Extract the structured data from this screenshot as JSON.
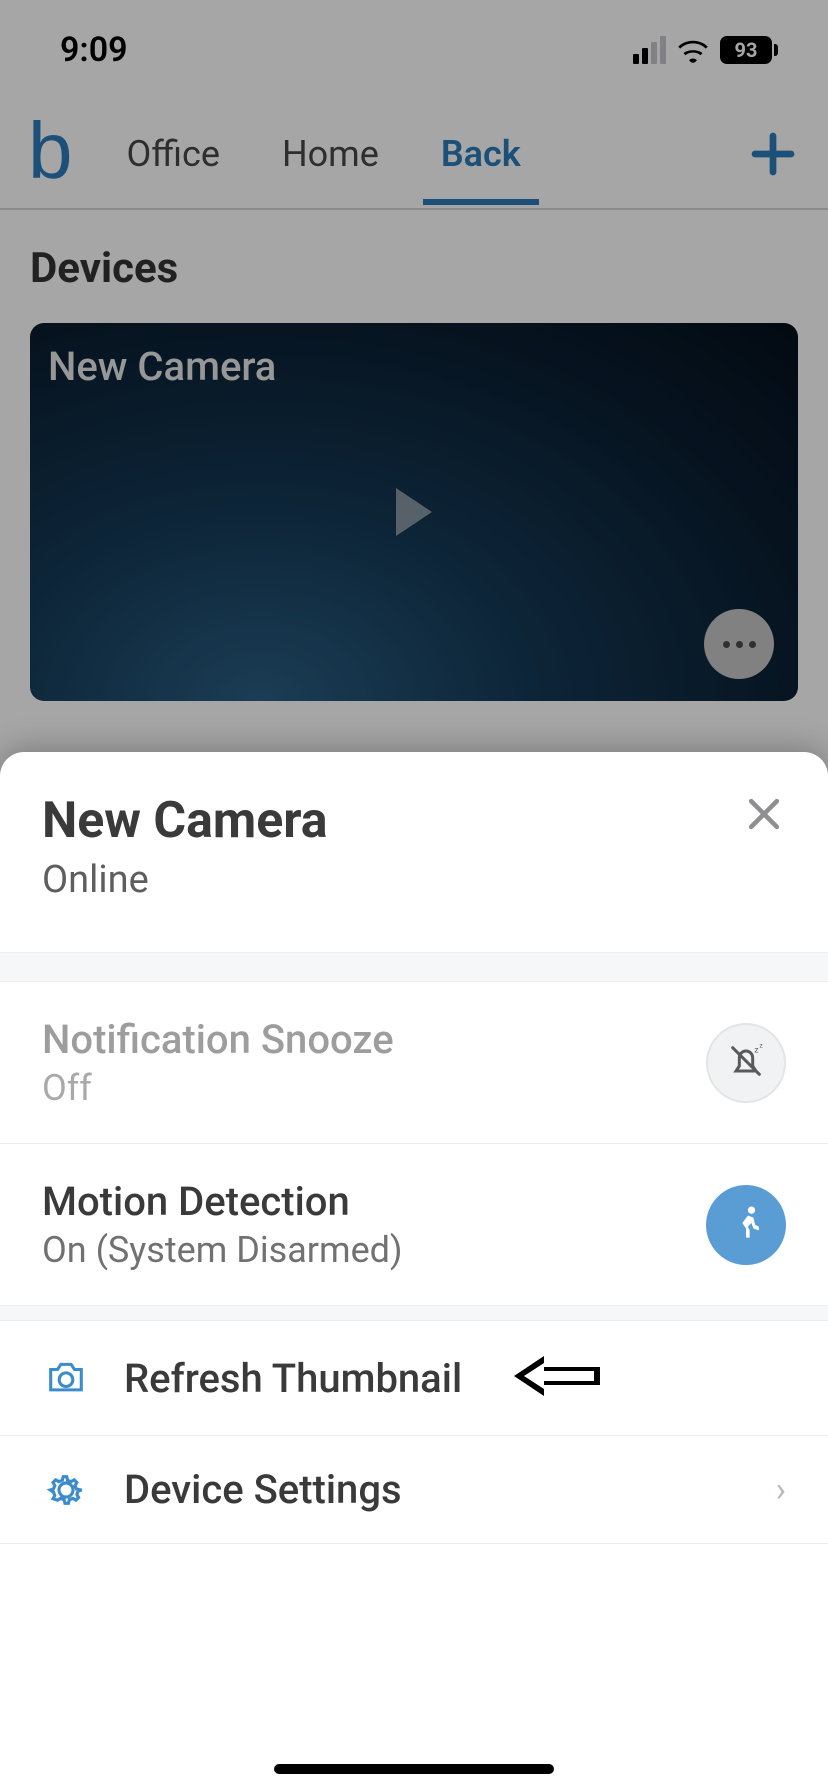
{
  "status": {
    "time": "9:09",
    "battery": "93"
  },
  "nav": {
    "tabs": [
      {
        "label": "Office",
        "active": false
      },
      {
        "label": "Home",
        "active": false
      },
      {
        "label": "Back",
        "active": true
      }
    ]
  },
  "section": {
    "heading": "Devices"
  },
  "camera_preview": {
    "name": "New Camera"
  },
  "sheet": {
    "title": "New Camera",
    "status": "Online",
    "snooze": {
      "label": "Notification Snooze",
      "value": "Off"
    },
    "motion": {
      "label": "Motion Detection",
      "value": "On (System Disarmed)"
    },
    "refresh": {
      "label": "Refresh Thumbnail"
    },
    "settings": {
      "label": "Device Settings"
    }
  }
}
